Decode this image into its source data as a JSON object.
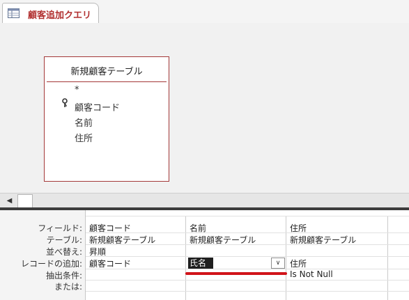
{
  "tab": {
    "title": "顧客追加クエリ",
    "icon": "query-icon"
  },
  "table": {
    "title": "新規顧客テーブル",
    "fields": [
      "*",
      "顧客コード",
      "名前",
      "住所"
    ],
    "key_icon": "key-icon",
    "border_color": "#a33838"
  },
  "grid": {
    "row_labels": [
      "フィールド:",
      "テーブル:",
      "並べ替え:",
      "レコードの追加:",
      "抽出条件:",
      "または:"
    ],
    "columns": [
      {
        "field": "顧客コード",
        "table": "新規顧客テーブル",
        "sort": "昇順",
        "append": "顧客コード",
        "criteria": "",
        "or": ""
      },
      {
        "field": "名前",
        "table": "新規顧客テーブル",
        "sort": "",
        "append": "氏名",
        "criteria": "",
        "or": ""
      },
      {
        "field": "住所",
        "table": "新規顧客テーブル",
        "sort": "",
        "append": "住所",
        "criteria": "Is Not Null",
        "or": ""
      }
    ],
    "highlight_color": "#d1141a"
  },
  "scrollbar": {
    "left_arrow": "◀"
  },
  "combo": {
    "arrow": "∨"
  }
}
